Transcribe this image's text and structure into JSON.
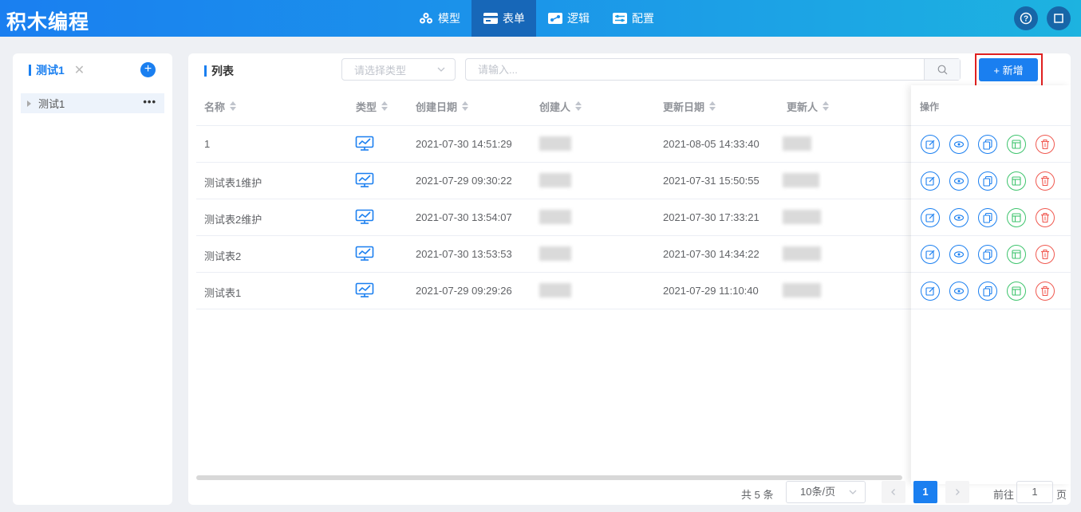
{
  "header": {
    "logo": "积木编程",
    "nav": [
      {
        "label": "模型",
        "icon": "cubes-icon",
        "active": false
      },
      {
        "label": "表单",
        "icon": "card-icon",
        "active": true
      },
      {
        "label": "逻辑",
        "icon": "flow-icon",
        "active": false
      },
      {
        "label": "配置",
        "icon": "settings-panel-icon",
        "active": false
      }
    ],
    "right_icons": [
      "help-icon",
      "fullscreen-icon"
    ]
  },
  "sidebar": {
    "tab_label": "测试1",
    "tab_close": "✕",
    "add": "+",
    "tree": [
      {
        "label": "测试1",
        "more": "•••"
      }
    ]
  },
  "main": {
    "title": "列表",
    "type_select_placeholder": "请选择类型",
    "search_placeholder": "请输入...",
    "add_button": "+ 新增",
    "columns": [
      "名称",
      "类型",
      "创建日期",
      "创建人",
      "更新日期",
      "更新人",
      "操作"
    ],
    "rows": [
      {
        "name": "1",
        "created": "2021-07-30 14:51:29",
        "updated": "2021-08-05 14:33:40"
      },
      {
        "name": "测试表1维护",
        "created": "2021-07-29 09:30:22",
        "updated": "2021-07-31 15:50:55"
      },
      {
        "name": "测试表2维护",
        "created": "2021-07-30 13:54:07",
        "updated": "2021-07-30 17:33:21"
      },
      {
        "name": "测试表2",
        "created": "2021-07-30 13:53:53",
        "updated": "2021-07-30 14:34:22"
      },
      {
        "name": "测试表1",
        "created": "2021-07-29 09:29:26",
        "updated": "2021-07-29 11:10:40"
      }
    ],
    "row_actions": [
      "edit-icon",
      "view-icon",
      "copy-icon",
      "layout-icon",
      "delete-icon"
    ]
  },
  "pagination": {
    "total": "共 5 条",
    "page_size": "10条/页",
    "current_page": "1",
    "goto_label": "前往",
    "goto_value": "1",
    "goto_unit": "页"
  },
  "colors": {
    "primary": "#1a7ff0",
    "success": "#3ec46d",
    "danger": "#f0584f",
    "highlight_box": "#e02020"
  }
}
